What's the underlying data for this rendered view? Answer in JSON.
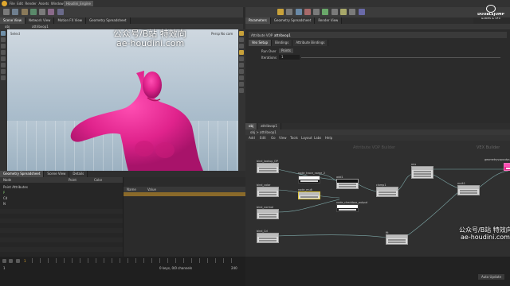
{
  "menu_bar": {
    "items": [
      "File",
      "Edit",
      "Render",
      "Assets",
      "Windows",
      "Labs",
      "Help"
    ],
    "scene_label": "Houdini_Engine"
  },
  "top_tabs": {
    "left": [
      "Scene View",
      "Network View",
      "Motion FX View",
      "Geometry Spreadsheet"
    ],
    "right": [
      "Parameters",
      "Geometry Spreadsheet",
      "Render View"
    ]
  },
  "viewport": {
    "path_text": "obj",
    "geo_text": "attribvop1",
    "view_label": "Select",
    "persp_label": "Persp",
    "cam_label": "No cam"
  },
  "parameters": {
    "node_type": "Attribute VOP",
    "node_name": "attribvop1",
    "tabs": [
      "Vex Setup",
      "Bindings",
      "Attribute Bindings",
      "Run Over",
      "Iterations"
    ],
    "rows": [
      {
        "label": "Run Over",
        "value": "Points"
      },
      {
        "label": "Iterations",
        "value": "1"
      }
    ]
  },
  "network": {
    "tabs": [
      "obj",
      "attribvop1"
    ],
    "path": "obj  >  attribvop1",
    "menu": [
      "Add",
      "Edit",
      "Go",
      "View",
      "Tools",
      "Layout",
      "Labs",
      "Help"
    ],
    "context_title": "Attribute VOP Builder",
    "builder_label": "VEX Builder",
    "nodes": [
      {
        "name": "bind_lookup_OP",
        "id": "n1"
      },
      {
        "name": "bind_color",
        "id": "n2"
      },
      {
        "name": "bind_normal",
        "id": "n3"
      },
      {
        "name": "bind_Cd",
        "id": "n4"
      },
      {
        "name": "node_trace_name_2",
        "id": "n5"
      },
      {
        "name": "node_mult",
        "id": "n6"
      },
      {
        "name": "add1",
        "id": "n7"
      },
      {
        "name": "node_checkbox_output",
        "id": "n8"
      },
      {
        "name": "clamp1",
        "id": "n9"
      },
      {
        "name": "mix",
        "id": "n10"
      },
      {
        "name": "mult1",
        "id": "n11"
      },
      {
        "name": "geometryvopoutput1",
        "id": "n12"
      },
      {
        "name": "fit",
        "id": "n13"
      }
    ]
  },
  "spreadsheet": {
    "tabs": [
      "Geometry Spreadsheet",
      "Scene View",
      "Details"
    ],
    "columns": [
      "Node",
      "Point",
      "Color"
    ],
    "detail_cols": [
      "Name",
      "Value"
    ],
    "rows": [
      "Point Attributes",
      "P",
      "Cd",
      "N"
    ]
  },
  "timeline": {
    "frame": "1",
    "start": "1",
    "end": "240",
    "keys_label": "0 keys, 0/0 channels",
    "auto_update": "Auto Update"
  },
  "watermark": {
    "cn_text": "公众号/B站 特效向",
    "url": "ae-houdini.com",
    "brand_top": "DOUBLEJUMP",
    "brand_sub": "GAMES & VFX"
  },
  "colors": {
    "accent_yellow": "#e0a82e",
    "model_magenta": "#e0238c",
    "panel": "#2b2b2b",
    "viewport_top": "#c9d3dc",
    "viewport_bottom": "#9eb4c4"
  }
}
